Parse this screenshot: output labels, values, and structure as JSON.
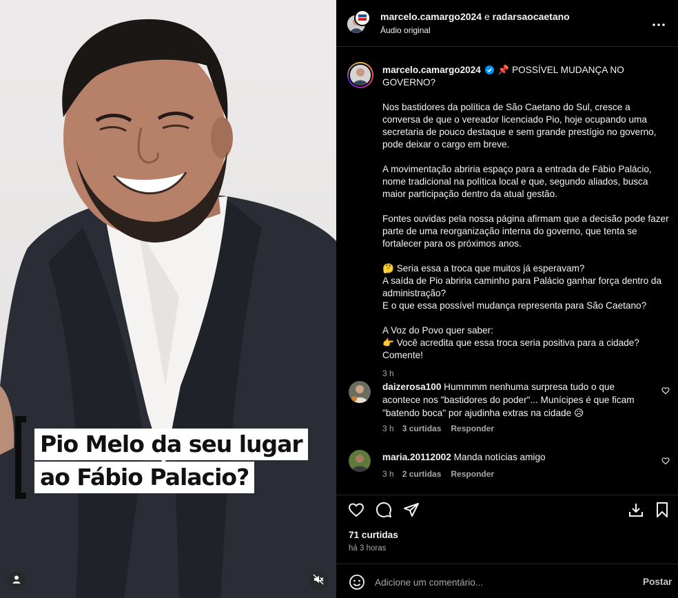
{
  "media": {
    "caption_line1": "Pio Melo da seu lugar",
    "caption_line2": "ao Fábio Palacio?",
    "user_icon": "person-icon",
    "mute_icon": "speaker-muted-icon"
  },
  "header": {
    "user1": "marcelo.camargo2024",
    "separator": " e ",
    "user2": "radarsaocaetano",
    "audio": "Áudio original",
    "more_icon": "more-horizontal-icon"
  },
  "post": {
    "username": "marcelo.camargo2024",
    "verified_icon": "verified-badge-icon",
    "pin_emoji": "📌",
    "title": "POSSÍVEL MUDANÇA NO GOVERNO?",
    "p1": "Nos bastidores da política de São Caetano do Sul, cresce a conversa de que o vereador licenciado Pio, hoje ocupando uma secretaria de pouco destaque e sem grande prestígio no governo, pode deixar o cargo em breve.",
    "p2": "A movimentação abriria espaço para a entrada de Fábio Palácio, nome tradicional na política local e que, segundo aliados, busca maior participação dentro da atual gestão.",
    "p3": "Fontes ouvidas pela nossa página afirmam que a decisão pode fazer parte de uma reorganização interna do governo, que tenta se fortalecer para os próximos anos.",
    "p4_line1": "🤔 Seria essa a troca que muitos já esperavam?",
    "p4_line2": "A saída de Pio abriria caminho para Palácio ganhar força dentro da administração?",
    "p4_line3": "E o que essa possível mudança representa para São Caetano?",
    "p5_line1": "A Voz do Povo quer saber:",
    "p5_line2": "👉 Você acredita que essa troca seria positiva para a cidade?",
    "p5_line3": "Comente!",
    "time": "3 h"
  },
  "comments": [
    {
      "username": "daizerosa100",
      "text": " Hummmm nenhuma surpresa tudo o que acontece nos \"bastidores do poder\"... Munícipes é que ficam \"batendo boca\" por ajudinha extras na cidade 😥",
      "time": "3 h",
      "likes": "3 curtidas",
      "reply": "Responder"
    },
    {
      "username": "maria.20112002",
      "text": " Manda notícias amigo",
      "time": "3 h",
      "likes": "2 curtidas",
      "reply": "Responder"
    }
  ],
  "actions": {
    "like_icon": "heart-icon",
    "comment_icon": "comment-icon",
    "share_icon": "send-icon",
    "download_icon": "download-icon",
    "save_icon": "bookmark-icon",
    "likes": "71 curtidas",
    "ago": "há 3 horas"
  },
  "composer": {
    "emoji_icon": "emoji-icon",
    "placeholder": "Adicione um comentário...",
    "post_label": "Postar"
  }
}
